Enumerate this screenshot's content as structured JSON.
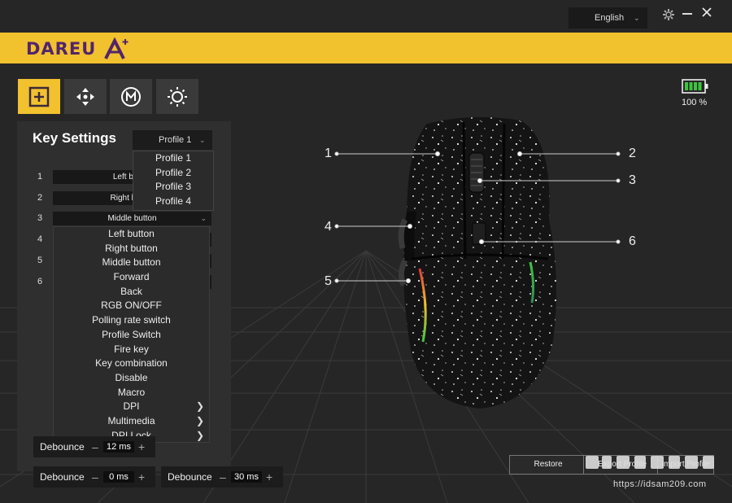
{
  "window": {
    "language": "English",
    "settings_icon": "gear-icon",
    "minimize_icon": "minimize-icon",
    "close_icon": "close-icon"
  },
  "brand": {
    "name": "DAREU"
  },
  "tabs": [
    {
      "name": "key-settings",
      "icon": "plus-square-icon",
      "active": true
    },
    {
      "name": "dpi",
      "icon": "move-arrows-icon",
      "active": false
    },
    {
      "name": "macro",
      "icon": "macro-m-icon",
      "active": false
    },
    {
      "name": "lighting",
      "icon": "sun-icon",
      "active": false
    }
  ],
  "battery": {
    "text": "100 %",
    "level": 1.0,
    "color": "#3ec43e"
  },
  "key_settings": {
    "title": "Key Settings",
    "profile_selected": "Profile 1",
    "profiles": [
      "Profile 1",
      "Profile 2",
      "Profile 3",
      "Profile 4"
    ],
    "rows": [
      {
        "num": "1",
        "value": "Left button"
      },
      {
        "num": "2",
        "value": "Right button"
      },
      {
        "num": "3",
        "value": "Middle button"
      },
      {
        "num": "4",
        "value": ""
      },
      {
        "num": "5",
        "value": ""
      },
      {
        "num": "6",
        "value": ""
      }
    ],
    "functions": [
      {
        "label": "Left button",
        "sub": false
      },
      {
        "label": "Right button",
        "sub": false
      },
      {
        "label": "Middle button",
        "sub": false
      },
      {
        "label": "Forward",
        "sub": false
      },
      {
        "label": "Back",
        "sub": false
      },
      {
        "label": "RGB ON/OFF",
        "sub": false
      },
      {
        "label": "Polling rate switch",
        "sub": false
      },
      {
        "label": "Profile Switch",
        "sub": false
      },
      {
        "label": "Fire key",
        "sub": false
      },
      {
        "label": "Key combination",
        "sub": false
      },
      {
        "label": "Disable",
        "sub": false
      },
      {
        "label": "Macro",
        "sub": false
      },
      {
        "label": "DPI",
        "sub": true
      },
      {
        "label": "Multimedia",
        "sub": true
      },
      {
        "label": "DPI Lock",
        "sub": true
      }
    ],
    "debounce": [
      {
        "label": "Debounce",
        "value": "12 ms"
      },
      {
        "label": "Debounce",
        "value": "0 ms"
      },
      {
        "label": "Debounce",
        "value": "30 ms"
      }
    ]
  },
  "mouse_labels": [
    "1",
    "2",
    "3",
    "4",
    "5",
    "6"
  ],
  "actions": {
    "restore": "Restore",
    "export": "Export Profile",
    "import": "Import Profile"
  },
  "watermark": {
    "text": "https://idsam209.com"
  },
  "colors": {
    "accent": "#f2c12e",
    "brand": "#52256b",
    "panel": "#2f2f2f"
  }
}
